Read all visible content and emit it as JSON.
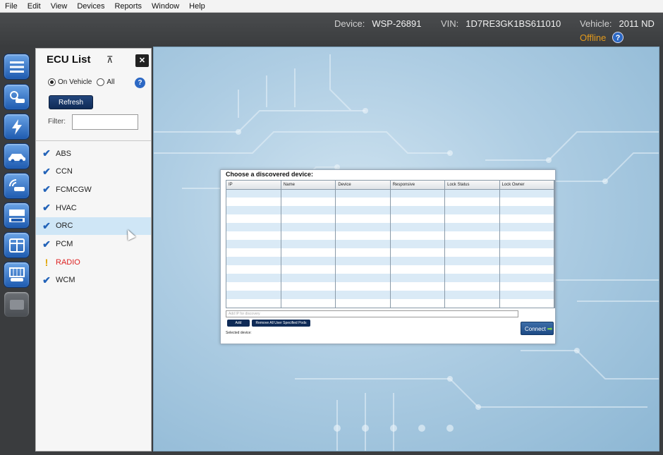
{
  "menu": [
    "File",
    "Edit",
    "View",
    "Devices",
    "Reports",
    "Window",
    "Help"
  ],
  "header": {
    "device_label": "Device:",
    "device_value": "WSP-26891",
    "vin_label": "VIN:",
    "vin_value": "1D7RE3GK1BS611010",
    "vehicle_label": "Vehicle:",
    "vehicle_value": "2011 ND",
    "status": "Offline",
    "help": "?"
  },
  "toolbar": {
    "icons": [
      "menu-icon",
      "vehicle-search-icon",
      "flash-icon",
      "car-icon",
      "wireless-icon",
      "meter-icon",
      "panels-icon",
      "lift-icon",
      "disabled-icon"
    ]
  },
  "ecu_panel": {
    "title": "ECU List",
    "pin_icon": "⊼",
    "close": "✕",
    "radio_on_vehicle": "On Vehicle",
    "radio_all": "All",
    "selected_radio": "On Vehicle",
    "help": "?",
    "refresh_label": "Refresh",
    "filter_label": "Filter:",
    "filter_value": "",
    "items": [
      {
        "name": "ABS",
        "status": "check"
      },
      {
        "name": "CCN",
        "status": "check"
      },
      {
        "name": "FCMCGW",
        "status": "check"
      },
      {
        "name": "HVAC",
        "status": "check"
      },
      {
        "name": "ORC",
        "status": "check",
        "selected": true
      },
      {
        "name": "PCM",
        "status": "check"
      },
      {
        "name": "RADIO",
        "status": "warning"
      },
      {
        "name": "WCM",
        "status": "check"
      }
    ],
    "check_glyph": "✔",
    "warn_glyph": "!"
  },
  "dialog": {
    "title": "Choose a discovered device:",
    "columns": [
      "IP",
      "Name",
      "Device",
      "Responsive",
      "Lock Status",
      "Lock Owner"
    ],
    "ip_placeholder": "Add IP for discovery",
    "add_label": "Add",
    "remove_label": "Remove All User Specified Pods",
    "selected_device_label": "Selected device:",
    "connect_label": "Connect",
    "connect_arrow": "➡"
  }
}
